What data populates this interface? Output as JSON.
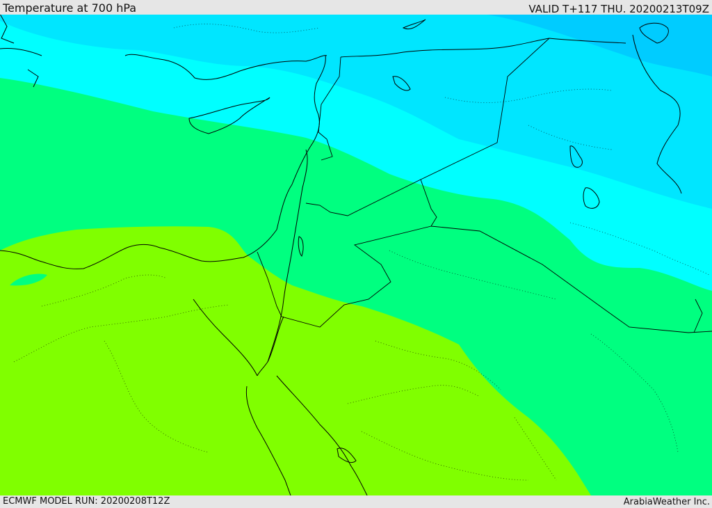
{
  "header": {
    "title": "Temperature at 700 hPa",
    "valid": "VALID T+117 THU. 20200213T09Z"
  },
  "footer": {
    "model_run": "ECMWF MODEL RUN: 20200208T12Z",
    "credit": "ArabiaWeather Inc."
  },
  "map": {
    "colors": {
      "band_cyan_dark": "#00ccff",
      "band_cyan_mid": "#00e6ff",
      "band_cyan": "#00ffff",
      "band_green": "#00ff80",
      "band_lime": "#80ff00",
      "boundary": "#000000"
    }
  }
}
